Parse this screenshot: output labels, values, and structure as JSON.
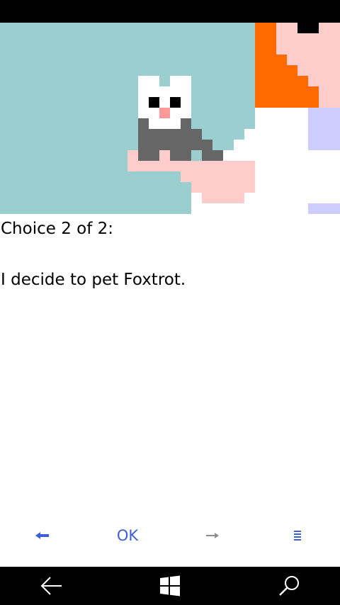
{
  "story": {
    "choice_header": "Choice 2 of 2:",
    "text": "I decide to pet Foxtrot."
  },
  "nav": {
    "back_icon": "left-arrow-icon",
    "ok_label": "OK",
    "forward_icon": "right-arrow-icon",
    "menu_icon": "menu-lines-icon",
    "active_color": "#3c5fd8",
    "disabled_color": "#8c8c8c"
  },
  "system_bar": {
    "back_icon": "back-arrow-icon",
    "start_icon": "windows-logo-icon",
    "search_icon": "search-icon"
  },
  "illustration": {
    "subject": "pixel-art cat held in a hand",
    "colors": {
      "sky": "#9bcfcf",
      "orange": "#ff6a00",
      "pink": "#ffcccc",
      "lavender": "#ccccff",
      "cat_gray": "#666666",
      "nose": "#ff9999"
    }
  }
}
